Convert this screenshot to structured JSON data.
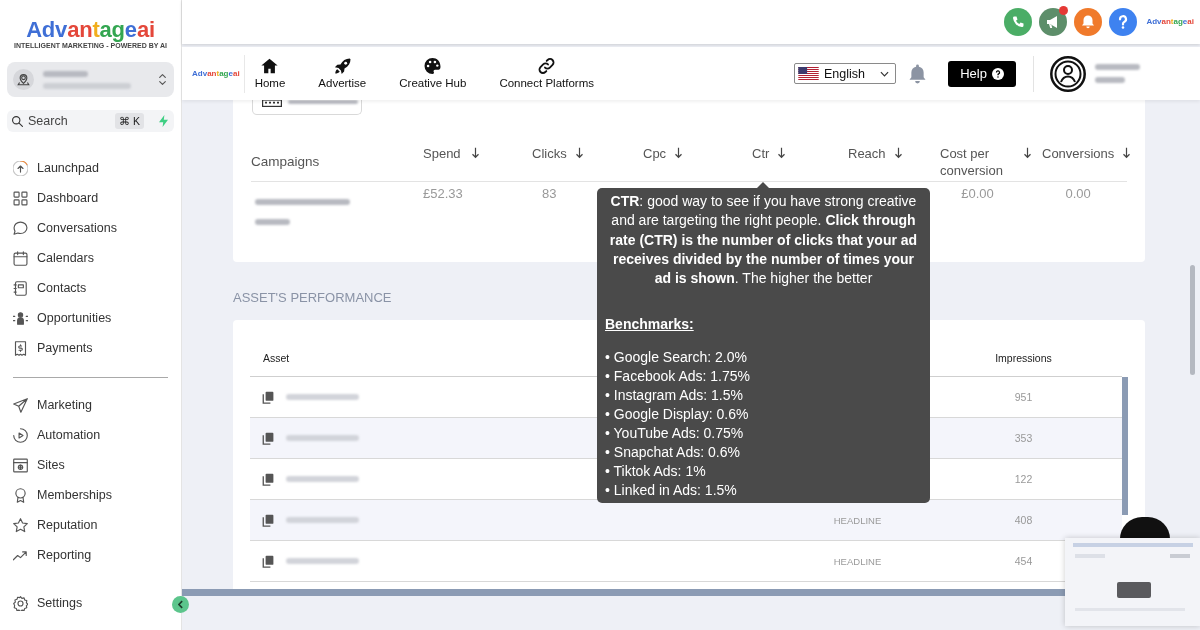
{
  "sidebar": {
    "logo": {
      "name": "Advantageai",
      "tagline": "INTELLIGENT MARKETING - POWERED BY AI"
    },
    "search": {
      "placeholder": "Search",
      "shortcut": "⌘ K"
    },
    "nav_groups": [
      {
        "items": [
          "Launchpad",
          "Dashboard",
          "Conversations",
          "Calendars",
          "Contacts",
          "Opportunities",
          "Payments"
        ]
      },
      {
        "items": [
          "Marketing",
          "Automation",
          "Sites",
          "Memberships",
          "Reputation",
          "Reporting"
        ]
      }
    ],
    "settings": "Settings"
  },
  "topbar": {
    "logo": "Advantageai",
    "announcements_unread": true
  },
  "navbar": {
    "logo": "Advantageai",
    "items": [
      "Home",
      "Advertise",
      "Creative Hub",
      "Connect Platforms"
    ],
    "language": "English",
    "help_button": "Help"
  },
  "campaigns": {
    "columns": [
      {
        "label": "Campaigns",
        "sortable": false
      },
      {
        "label": "Spend",
        "sortable": true
      },
      {
        "label": "Clicks",
        "sortable": true
      },
      {
        "label": "Cpc",
        "sortable": true
      },
      {
        "label": "Ctr",
        "sortable": true
      },
      {
        "label": "Reach",
        "sortable": true
      },
      {
        "label": "Cost per conversion",
        "sortable": true
      },
      {
        "label": "Conversions",
        "sortable": true
      }
    ],
    "rows": [
      {
        "cells": [
          "",
          "£52.33",
          "83",
          "",
          "",
          "",
          "£0.00",
          "0.00"
        ]
      }
    ]
  },
  "assets": {
    "title": "ASSET'S PERFORMANCE",
    "columns": {
      "asset": "Asset",
      "impressions": "Impressions"
    },
    "rows": [
      {
        "impressions": "951"
      },
      {
        "impressions": "353"
      },
      {
        "impressions": "122"
      },
      {
        "type": "HEADLINE",
        "impressions": "408"
      },
      {
        "type": "HEADLINE",
        "impressions": "454"
      }
    ]
  },
  "tooltip": {
    "paragraph": "**CTR**: good way to see if you have strong creative and are targeting the right people. **Click through rate (CTR) is the number of clicks that your ad receives divided by the number of times your ad is shown**. The higher the better",
    "heading": "Benchmarks:",
    "items": [
      "• Google Search: 2.0%",
      "• Facebook Ads: 1.75%",
      "• Instagram Ads: 1.5%",
      "• Google Display: 0.6%",
      "• YouTube Ads: 0.75%",
      "• Snapchat Ads: 0.6%",
      "• Tiktok Ads: 1%",
      "• Linked in Ads: 1.5%"
    ]
  }
}
